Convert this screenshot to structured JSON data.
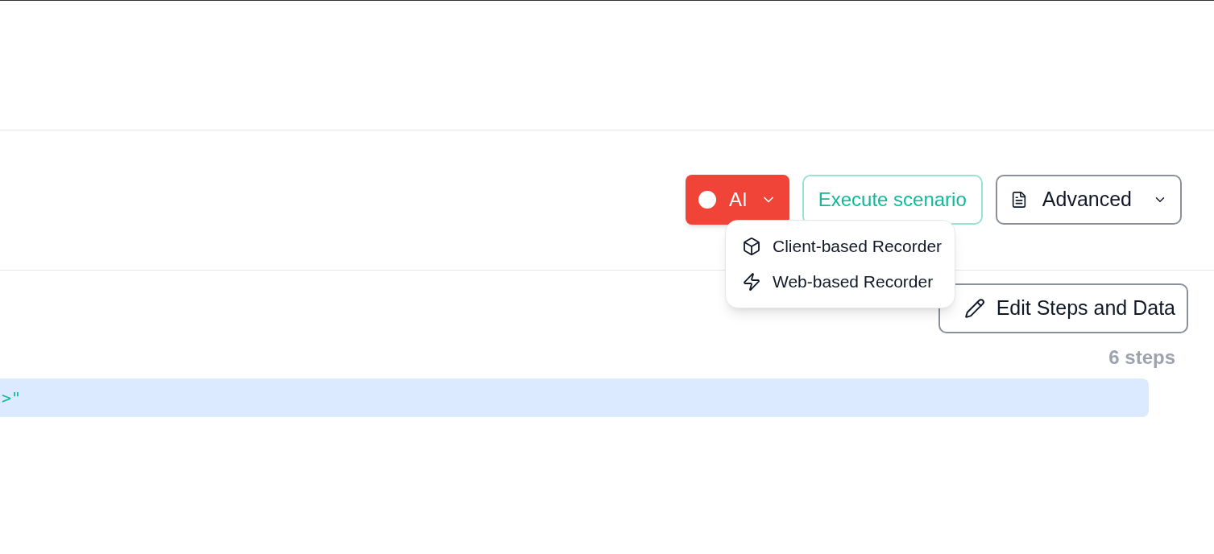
{
  "toolbar": {
    "record_button": {
      "label": "AI"
    },
    "execute_button": {
      "label": "Execute scenario"
    },
    "advanced_button": {
      "label": "Advanced"
    }
  },
  "record_menu": {
    "items": [
      {
        "kind": "client",
        "label": "Client-based Recorder"
      },
      {
        "kind": "web",
        "label": "Web-based Recorder"
      }
    ]
  },
  "steps": {
    "edit_button": {
      "label": "Edit Steps and Data"
    },
    "count": "6 steps",
    "rows": [
      {
        "text": ">\"",
        "selected": true
      }
    ]
  }
}
